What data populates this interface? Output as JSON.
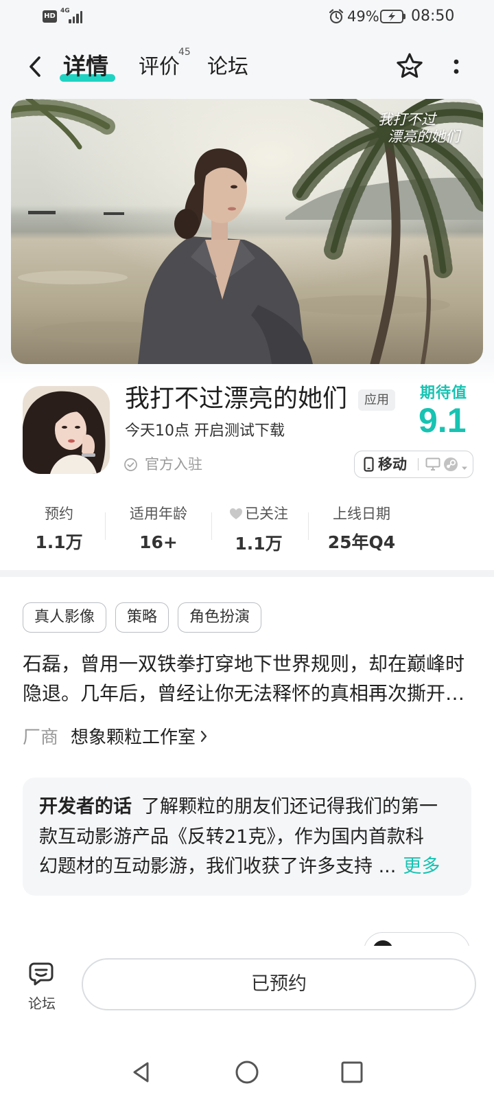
{
  "status_bar": {
    "hd_label": "HD",
    "network": "4G",
    "battery": "49%",
    "time": "08:50",
    "icons": [
      "signal-icon",
      "alarm-icon",
      "battery-charging-icon"
    ]
  },
  "header": {
    "back_icon": "chevron-left-icon",
    "tabs": [
      {
        "label": "详情",
        "active": true
      },
      {
        "label": "评价",
        "badge": "45"
      },
      {
        "label": "论坛"
      }
    ],
    "follow_icon": "star-icon",
    "more_icon": "more-vertical-icon"
  },
  "banner": {
    "logo_lines": [
      "我打不过",
      "漂亮的她们"
    ]
  },
  "app": {
    "title": "我打不过漂亮的她们",
    "type_badge": "应用",
    "subtitle": "今天10点 开启测试下载",
    "official_label": "官方入驻",
    "rating_label": "期待值",
    "rating_value": "9.1",
    "platform": {
      "selected": "移动",
      "icons": [
        "phone-icon",
        "desktop-icon",
        "steam-icon",
        "chevron-down-icon"
      ]
    }
  },
  "stats": [
    {
      "label": "预约",
      "value": "1.1万"
    },
    {
      "label": "适用年龄",
      "value": "16+"
    },
    {
      "label": "已关注",
      "value": "1.1万",
      "icon": "heart-icon"
    },
    {
      "label": "上线日期",
      "value": "25年Q4"
    }
  ],
  "tags": [
    "真人影像",
    "策略",
    "角色扮演"
  ],
  "description_lines": [
    "石磊，曾用一双铁拳打穿地下世界规则，却在巅峰时",
    "隐退。几年后，曾经让你无法释怀的真相再次撕开…"
  ],
  "vendor": {
    "label": "厂商",
    "name": "想象颗粒工作室"
  },
  "developer_note": {
    "label": "开发者的话",
    "lines": [
      "了解颗粒的朋友们还记得我们的第一",
      "款互动影游产品《反转21克》，作为国内首款科",
      "幻题材的互动影游，我们收获了许多支持 ..."
    ],
    "more": "更多"
  },
  "bottom_bar": {
    "forum_label": "论坛",
    "reserve_button": "已预约",
    "forum_icon": "chat-bubble-icon"
  },
  "system_nav": {
    "icons": [
      "nav-back-icon",
      "nav-home-icon",
      "nav-recents-icon"
    ]
  },
  "colors": {
    "accent": "#17c3b2",
    "text": "#222222",
    "muted": "#999999",
    "panel": "#f5f6f8"
  }
}
